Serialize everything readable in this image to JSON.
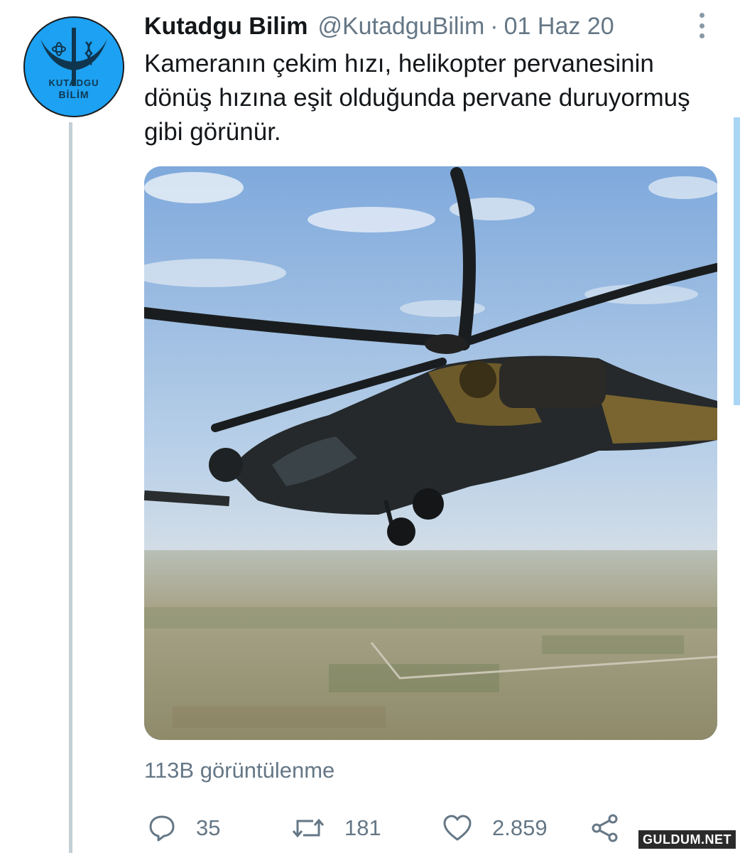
{
  "tweet": {
    "author_name": "Kutadgu Bilim",
    "handle": "@KutadguBilim",
    "separator": "·",
    "date": "01 Haz 20",
    "text": "Kameranın çekim hızı, helikopter pervanesinin dönüş hızına eşit olduğunda pervane duruyormuş gibi görünür.",
    "avatar": {
      "line1": "KUTADGU",
      "line2": "BİLİM",
      "bg_color": "#1da1f2"
    },
    "media": {
      "type": "video-frame",
      "subject": "helicopter-image"
    },
    "views": "113B görüntülenme",
    "actions": {
      "reply_count": "35",
      "retweet_count": "181",
      "like_count": "2.859"
    }
  },
  "icons": {
    "more": "more-vertical-icon",
    "reply": "reply-icon",
    "retweet": "retweet-icon",
    "like": "heart-icon",
    "share": "share-icon"
  },
  "watermark": "GULDUM.NET",
  "colors": {
    "text": "#14171a",
    "secondary": "#657786",
    "accent": "#1da1f2",
    "thread_line": "#c4cfd6"
  }
}
